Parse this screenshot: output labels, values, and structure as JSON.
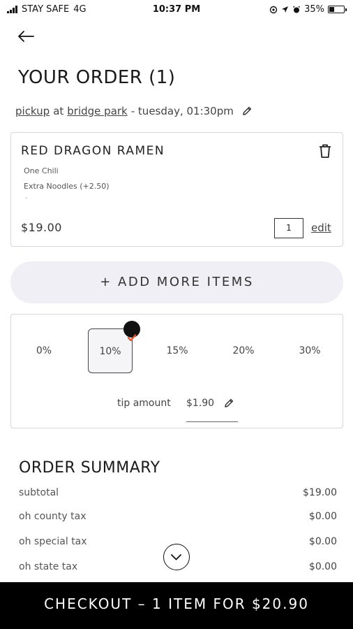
{
  "status_bar": {
    "carrier": "STAY SAFE",
    "network": "4G",
    "time": "10:37 PM",
    "battery": "35%"
  },
  "header": {
    "title": "YOUR ORDER (1)"
  },
  "pickup": {
    "mode": "pickup",
    "at": "at",
    "location": "bridge park",
    "when": "- tuesday, 01:30pm"
  },
  "cart_item": {
    "name": "RED DRAGON RAMEN",
    "modifiers": [
      "One Chili",
      "Extra Noodles (+2.50)"
    ],
    "extra_mark": "-",
    "price": "$19.00",
    "quantity": "1",
    "edit_label": "edit"
  },
  "add_more_label": "+ ADD MORE ITEMS",
  "tip": {
    "options": [
      "0%",
      "10%",
      "15%",
      "20%",
      "30%"
    ],
    "selected": "10%",
    "amount_label": "tip amount",
    "amount_value": "$1.90"
  },
  "summary": {
    "title": "ORDER SUMMARY",
    "rows": [
      {
        "label": "subtotal",
        "value": "$19.00"
      },
      {
        "label": "oh county tax",
        "value": "$0.00"
      },
      {
        "label": "oh special tax",
        "value": "$0.00"
      },
      {
        "label": "oh state tax",
        "value": "$0.00"
      }
    ]
  },
  "checkout_label": "CHECKOUT – 1 ITEM FOR $20.90",
  "icons": {
    "back": "arrow-left-icon",
    "edit": "pencil-icon",
    "delete": "trash-icon",
    "selected": "check-icon",
    "scroll": "chevron-down-icon"
  },
  "colors": {
    "checkout_bg": "#000000",
    "add_more_bg": "#efeff5",
    "check_badge": "#111111",
    "check_mark": "#e8542f"
  }
}
